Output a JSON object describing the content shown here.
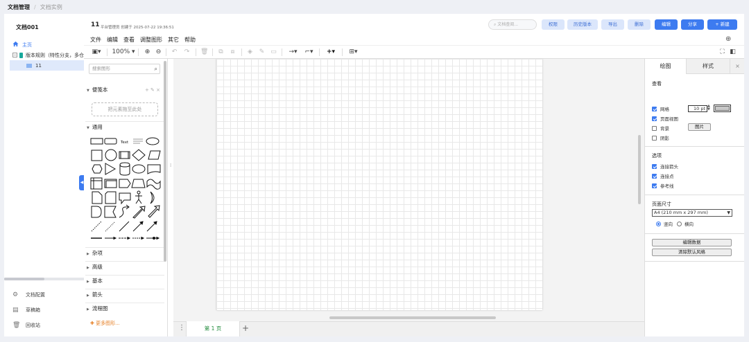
{
  "breadcrumb": {
    "root": "文档管理",
    "current": "文档实例"
  },
  "sidebar": {
    "doc_name": "文档001",
    "home": "主页",
    "version": "版本规则（特性分支，多仓",
    "page": "11",
    "bottom": [
      {
        "label": "文档配置",
        "icon": "gear-icon"
      },
      {
        "label": "草稿箱",
        "icon": "draft-icon"
      },
      {
        "label": "回收站",
        "icon": "trash-icon"
      }
    ]
  },
  "header": {
    "title": "11",
    "meta": "平台管理员 创建于 2025-07-22 19:36:51",
    "search_placeholder": "文档查阅...",
    "buttons": [
      "权限",
      "历史版本",
      "导出",
      "删除",
      "编辑",
      "分享",
      "+ 新建"
    ]
  },
  "menu": [
    "文件",
    "编辑",
    "查看",
    "调整图形",
    "其它",
    "帮助"
  ],
  "toolbar": {
    "zoom": "100%"
  },
  "shapes": {
    "search_placeholder": "搜索图形",
    "scratchpad": "便笺本",
    "dropzone": "把元素拖至此处",
    "general": "通用",
    "text_shape": "Text",
    "sections": [
      "杂项",
      "高级",
      "基本",
      "箭头",
      "流程图"
    ],
    "more": "更多图形..."
  },
  "canvas": {
    "page_tab": "第 1 页"
  },
  "format": {
    "tab_diagram": "绘图",
    "tab_style": "样式",
    "close": "×",
    "view_label": "查看",
    "grid": "网格",
    "grid_size": "10 pt",
    "page_view": "页面视图",
    "background": "背景",
    "image_btn": "图片",
    "shadow": "阴影",
    "options_label": "选项",
    "connection_arrows": "连接箭头",
    "connection_points": "连接点",
    "guides": "参考线",
    "paper_size_label": "页面尺寸",
    "paper_size": "A4 (210 mm x 297 mm)",
    "portrait": "竖向",
    "landscape": "横向",
    "edit_data": "编辑数据",
    "clear_style": "清除默认风格"
  },
  "colors": {
    "accent": "#3d7bf0",
    "light_btn": "#dbe6fb",
    "page_tab": "#1f8a3a",
    "more": "#e67e22"
  }
}
